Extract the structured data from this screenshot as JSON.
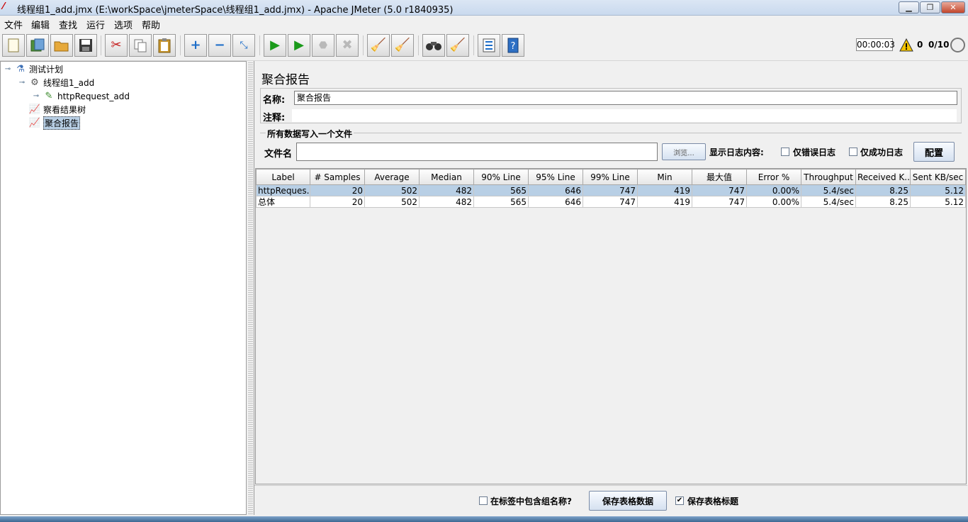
{
  "window": {
    "title": "线程组1_add.jmx (E:\\workSpace\\jmeterSpace\\线程组1_add.jmx) - Apache JMeter (5.0 r1840935)",
    "min_label": "▁",
    "max_label": "❐",
    "close_label": "✕"
  },
  "menu": [
    "文件",
    "编辑",
    "查找",
    "运行",
    "选项",
    "帮助"
  ],
  "toolbar": {
    "icons": [
      "new-icon",
      "templates-icon",
      "open-icon",
      "save-icon",
      "cut-icon",
      "copy-icon",
      "paste-icon",
      "expand-icon",
      "collapse-icon",
      "toggle-icon",
      "start-icon",
      "start-no-pause-icon",
      "stop-icon",
      "shutdown-icon",
      "clear-icon",
      "clear-all-icon",
      "search-icon",
      "reset-search-icon",
      "function-helper-icon",
      "help-icon"
    ],
    "timer": "00:00:03",
    "error_count": "0",
    "threads": "0/10"
  },
  "tree": {
    "test_plan": "测试计划",
    "thread_group": "线程组1_add",
    "sampler": "httpRequest_add",
    "listener1": "察看结果树",
    "listener2": "聚合报告"
  },
  "panel": {
    "title": "聚合报告",
    "name_label": "名称:",
    "name_value": "聚合报告",
    "comment_label": "注释:",
    "comment_value": "",
    "file_section": "所有数据写入一个文件",
    "file_label": "文件名",
    "file_value": "",
    "browse_label": "浏览...",
    "log_label": "显示日志内容:",
    "errors_only": "仅错误日志",
    "success_only": "仅成功日志",
    "configure": "配置"
  },
  "table": {
    "columns": [
      "Label",
      "# Samples",
      "Average",
      "Median",
      "90% Line",
      "95% Line",
      "99% Line",
      "Min",
      "最大值",
      "Error %",
      "Throughput",
      "Received K...",
      "Sent KB/sec"
    ],
    "rows": [
      [
        "httpReques...",
        "20",
        "502",
        "482",
        "565",
        "646",
        "747",
        "419",
        "747",
        "0.00%",
        "5.4/sec",
        "8.25",
        "5.12"
      ],
      [
        "总体",
        "20",
        "502",
        "482",
        "565",
        "646",
        "747",
        "419",
        "747",
        "0.00%",
        "5.4/sec",
        "8.25",
        "5.12"
      ]
    ]
  },
  "bottom": {
    "include_group_label": "在标签中包含组名称?",
    "include_group_checked": false,
    "save_table_data": "保存表格数据",
    "save_table_header": "保存表格标题",
    "save_table_header_checked": true
  }
}
